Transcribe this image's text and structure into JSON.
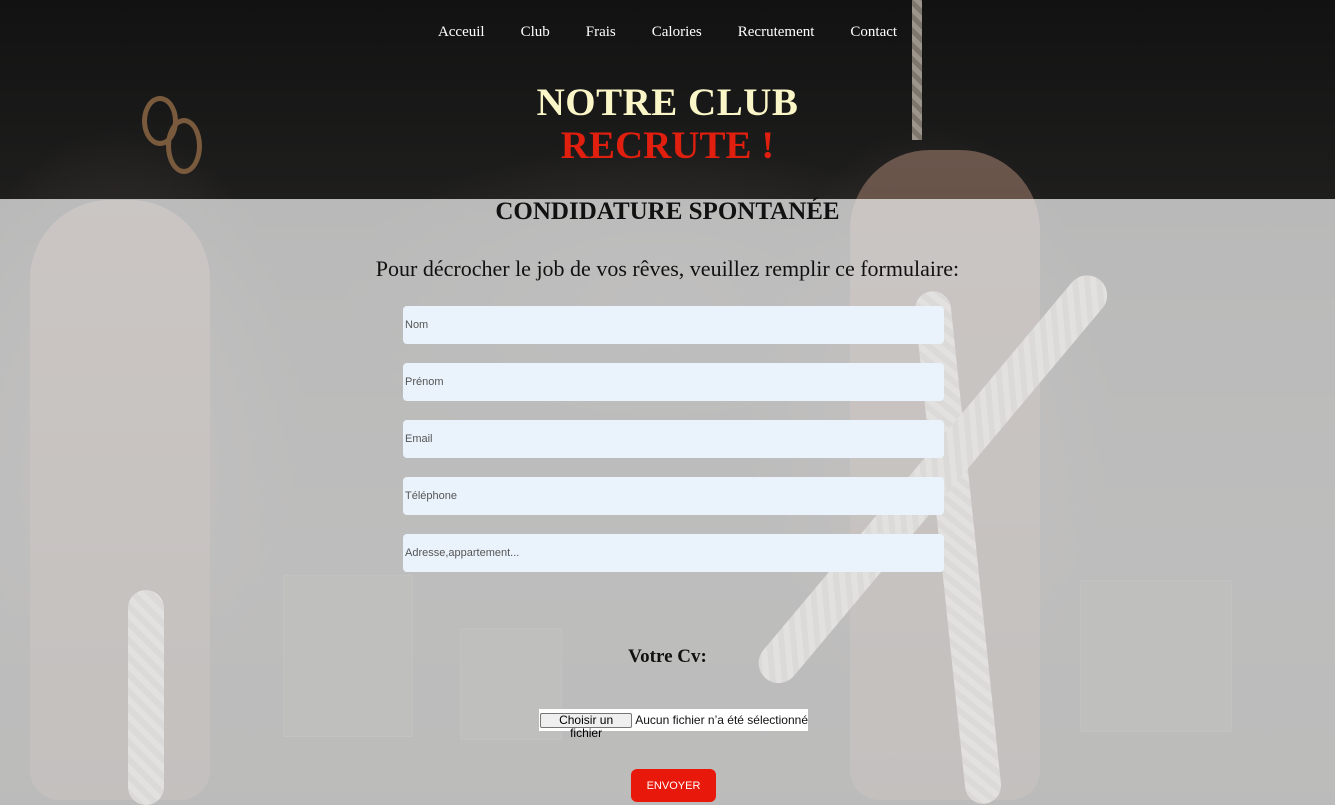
{
  "nav": {
    "items": [
      "Acceuil",
      "Club",
      "Frais",
      "Calories",
      "Recrutement",
      "Contact"
    ]
  },
  "hero": {
    "line1": "NOTRE CLUB",
    "line2": "RECRUTE !"
  },
  "form": {
    "title": "CONDIDATURE SPONTANÉE",
    "intro": "Pour décrocher le job de vos rêves, veuillez remplir ce formulaire:",
    "fields": {
      "nom": {
        "placeholder": "Nom",
        "value": ""
      },
      "prenom": {
        "placeholder": "Prénom",
        "value": ""
      },
      "email": {
        "placeholder": "Email",
        "value": ""
      },
      "telephone": {
        "placeholder": "Téléphone",
        "value": ""
      },
      "adresse": {
        "placeholder": "Adresse,appartement...",
        "value": ""
      }
    },
    "cv_label": "Votre Cv:",
    "file_button": "Choisir un fichier",
    "file_status": "Aucun fichier n’a été sélectionné",
    "submit_label": "ENVOYER"
  },
  "colors": {
    "hero_line1": "#fbf6c8",
    "hero_line2": "#e01f0f",
    "submit_bg": "#e8190b",
    "field_bg": "#eaf3fb"
  }
}
